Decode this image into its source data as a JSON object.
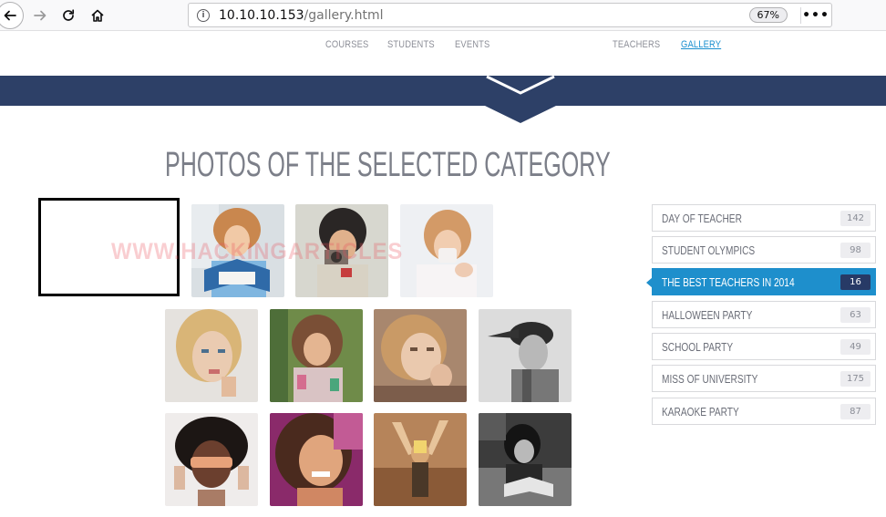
{
  "browser": {
    "url_host": "10.10.10.153",
    "url_path": "/gallery.html",
    "zoom": "67%",
    "more_label": "•••"
  },
  "nav": {
    "items": [
      {
        "label": "COURSES",
        "active": false
      },
      {
        "label": "STUDENTS",
        "active": false
      },
      {
        "label": "EVENTS",
        "active": false
      },
      {
        "label": "TEACHERS",
        "active": false
      },
      {
        "label": "GALLERY",
        "active": true
      }
    ]
  },
  "page": {
    "title": "PHOTOS OF THE SELECTED CATEGORY",
    "watermark": "WWW.HACKINGARTICLES"
  },
  "categories": [
    {
      "label": "DAY OF TEACHER",
      "count": "142",
      "active": false
    },
    {
      "label": "STUDENT OLYMPICS",
      "count": "98",
      "active": false
    },
    {
      "label": "THE BEST TEACHERS IN 2014",
      "count": "16",
      "active": true
    },
    {
      "label": "HALLOWEEN PARTY",
      "count": "63",
      "active": false
    },
    {
      "label": "SCHOOL PARTY",
      "count": "49",
      "active": false
    },
    {
      "label": "MISS OF UNIVERSITY",
      "count": "175",
      "active": false
    },
    {
      "label": "KARAOKE PARTY",
      "count": "87",
      "active": false
    }
  ],
  "colors": {
    "banner": "#2d4067",
    "accent": "#1e8fcc",
    "active_count_bg": "#273a66"
  }
}
